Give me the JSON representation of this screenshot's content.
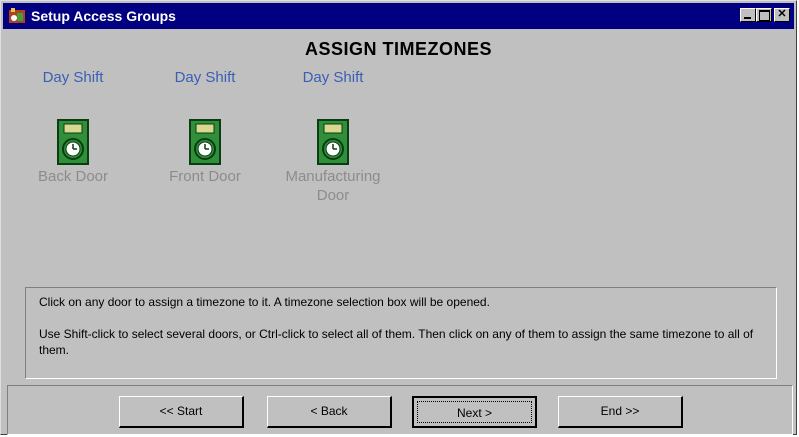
{
  "window": {
    "title": "Setup Access Groups",
    "controls": [
      "minimize",
      "maximize",
      "close"
    ]
  },
  "page": {
    "heading": "ASSIGN TIMEZONES"
  },
  "doors": [
    {
      "timezone": "Day Shift",
      "name": "Back Door",
      "icon": "door-clock-icon"
    },
    {
      "timezone": "Day Shift",
      "name": "Front Door",
      "icon": "door-clock-icon"
    },
    {
      "timezone": "Day Shift",
      "name_line1": "Manufacturing",
      "name_line2": "Door",
      "icon": "door-clock-icon"
    }
  ],
  "info": {
    "line1": "Click on any door to assign a timezone to it.  A timezone selection box will be opened.",
    "line2": "Use Shift-click to select several doors, or Ctrl-click to select all of them.  Then click on any of them to assign the same timezone to all of them."
  },
  "nav": {
    "start": "<< Start",
    "back": "< Back",
    "next": "Next >",
    "end": "End >>"
  },
  "colors": {
    "titlebar": "#000080",
    "timezone_text": "#3a5fb6",
    "door_name_text": "#8c8c8c",
    "door_icon_green": "#2f8f3a",
    "door_icon_panel": "#d8d890"
  }
}
